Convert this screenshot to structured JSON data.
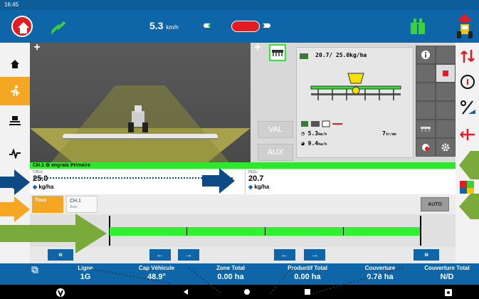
{
  "status": {
    "time": "16:45"
  },
  "topbar": {
    "speed_value": "5.3",
    "speed_unit": "km/h",
    "home_icon": "home-icon",
    "gps_icon": "satellite-icon",
    "implement_icon": "implement-icon",
    "tractor_icon": "tractor-icon"
  },
  "sidebar": {
    "items": [
      {
        "name": "home",
        "icon": "home-icon"
      },
      {
        "name": "run",
        "icon": "running-icon",
        "active": true
      },
      {
        "name": "tractor-settings",
        "icon": "tractor-settings-icon"
      },
      {
        "name": "diagnostics",
        "icon": "pulse-icon"
      },
      {
        "name": "usb",
        "icon": "usb-icon"
      }
    ]
  },
  "implement_panel": {
    "val_label": "VAL",
    "aux_label": "AUX",
    "rate_line": "20.7/  25.0kg/ha",
    "speed_line": "5.3",
    "speed_unit": "km/h",
    "count_line": "7",
    "count_unit": "tr/mn",
    "area_line": "9.4",
    "area_unit": "ha/h"
  },
  "channel": {
    "header": "CH.1",
    "product": "engrais",
    "mode": "Primaire",
    "target_label": "CIBLE",
    "target_value": "25.0",
    "target_unit": "kg/ha",
    "actual_label": "RÉEL",
    "actual_value": "20.7",
    "actual_unit": "kg/ha"
  },
  "tabs": [
    {
      "label": "Tous",
      "sub": ""
    },
    {
      "label": "CH.1",
      "sub": "Auto"
    }
  ],
  "auto_button": "AUTO",
  "nav_buttons": [
    "«",
    "←",
    "→",
    "←",
    "→",
    "»"
  ],
  "info": [
    {
      "label": "Ligne",
      "value": "1G"
    },
    {
      "label": "Cap Véhicule",
      "value": "48.9°"
    },
    {
      "label": "Zone Total",
      "value": "0.00 ha"
    },
    {
      "label": "Productif Total",
      "value": "0.00 ha"
    },
    {
      "label": "Couverture",
      "value": "0.78 ha"
    },
    {
      "label": "Couverture Total",
      "value": "N/D"
    }
  ],
  "colors": {
    "topbar": "#0e65a8",
    "accent_green": "#2ee82e",
    "active_orange": "#f5a623",
    "alert_red": "#e31b23",
    "annotation_blue": "#0e4a86",
    "annotation_green": "#7aab3a"
  }
}
